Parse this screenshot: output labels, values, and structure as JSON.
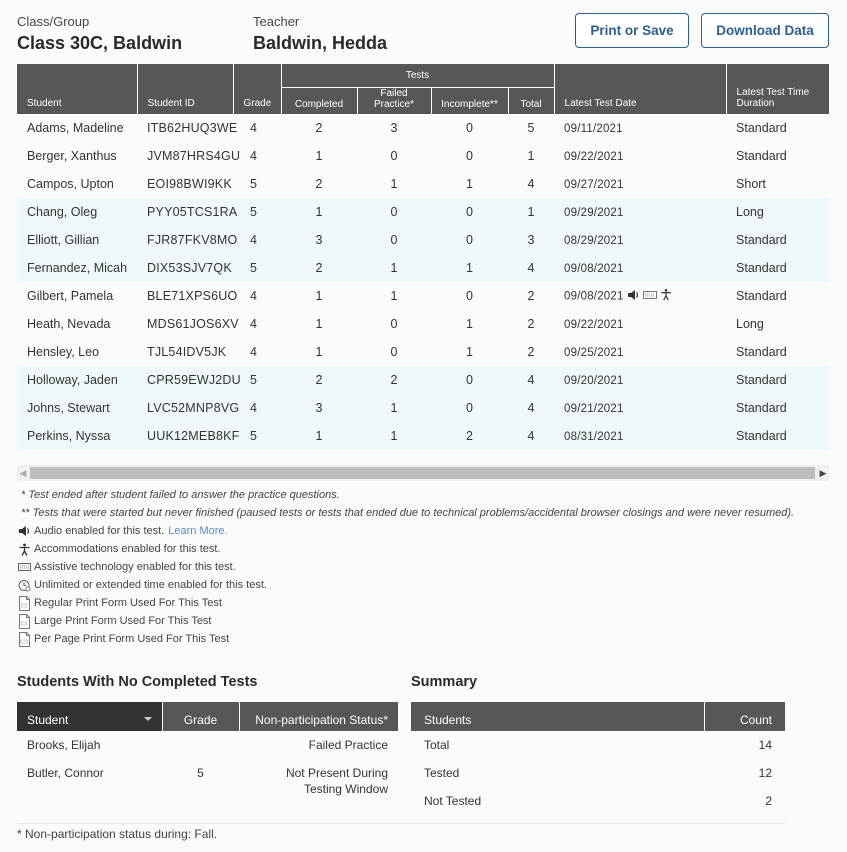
{
  "header": {
    "class_label": "Class/Group",
    "class_value": "Class 30C, Baldwin",
    "teacher_label": "Teacher",
    "teacher_value": "Baldwin, Hedda",
    "print_button": "Print or Save",
    "download_button": "Download Data"
  },
  "main_table": {
    "headers": {
      "student": "Student",
      "student_id": "Student ID",
      "grade": "Grade",
      "tests_group": "Tests",
      "completed": "Completed",
      "failed_practice": "Failed Practice*",
      "incomplete": "Incomplete**",
      "total": "Total",
      "latest_date": "Latest Test Date",
      "latest_duration": "Latest Test Time Duration"
    },
    "rows": [
      {
        "student": "Adams, Madeline",
        "id": "ITB62HUQ3WE",
        "grade": "4",
        "completed": "2",
        "failed": "3",
        "incomplete": "0",
        "total": "5",
        "date": "09/11/2021",
        "icons": [],
        "duration": "Standard",
        "highlight": false
      },
      {
        "student": "Berger, Xanthus",
        "id": "JVM87HRS4GU",
        "grade": "4",
        "completed": "1",
        "failed": "0",
        "incomplete": "0",
        "total": "1",
        "date": "09/22/2021",
        "icons": [],
        "duration": "Standard",
        "highlight": false
      },
      {
        "student": "Campos, Upton",
        "id": "EOI98BWI9KK",
        "grade": "5",
        "completed": "2",
        "failed": "1",
        "incomplete": "1",
        "total": "4",
        "date": "09/27/2021",
        "icons": [],
        "duration": "Short",
        "highlight": false
      },
      {
        "student": "Chang, Oleg",
        "id": "PYY05TCS1RA",
        "grade": "5",
        "completed": "1",
        "failed": "0",
        "incomplete": "0",
        "total": "1",
        "date": "09/29/2021",
        "icons": [],
        "duration": "Long",
        "highlight": true
      },
      {
        "student": "Elliott, Gillian",
        "id": "FJR87FKV8MO",
        "grade": "4",
        "completed": "3",
        "failed": "0",
        "incomplete": "0",
        "total": "3",
        "date": "08/29/2021",
        "icons": [],
        "duration": "Standard",
        "highlight": true
      },
      {
        "student": "Fernandez, Micah",
        "id": "DIX53SJV7QK",
        "grade": "5",
        "completed": "2",
        "failed": "1",
        "incomplete": "1",
        "total": "4",
        "date": "09/08/2021",
        "icons": [],
        "duration": "Standard",
        "highlight": true
      },
      {
        "student": "Gilbert, Pamela",
        "id": "BLE71XPS6UO",
        "grade": "4",
        "completed": "1",
        "failed": "1",
        "incomplete": "0",
        "total": "2",
        "date": "09/08/2021",
        "icons": [
          "audio-icon",
          "keyboard-icon",
          "accommodation-icon"
        ],
        "duration": "Standard",
        "highlight": false
      },
      {
        "student": "Heath, Nevada",
        "id": "MDS61JOS6XV",
        "grade": "4",
        "completed": "1",
        "failed": "0",
        "incomplete": "1",
        "total": "2",
        "date": "09/22/2021",
        "icons": [],
        "duration": "Long",
        "highlight": false
      },
      {
        "student": "Hensley, Leo",
        "id": "TJL54IDV5JK",
        "grade": "4",
        "completed": "1",
        "failed": "0",
        "incomplete": "1",
        "total": "2",
        "date": "09/25/2021",
        "icons": [],
        "duration": "Standard",
        "highlight": false
      },
      {
        "student": "Holloway, Jaden",
        "id": "CPR59EWJ2DU",
        "grade": "5",
        "completed": "2",
        "failed": "2",
        "incomplete": "0",
        "total": "4",
        "date": "09/20/2021",
        "icons": [],
        "duration": "Standard",
        "highlight": true
      },
      {
        "student": "Johns, Stewart",
        "id": "LVC52MNP8VG",
        "grade": "4",
        "completed": "3",
        "failed": "1",
        "incomplete": "0",
        "total": "4",
        "date": "09/21/2021",
        "icons": [],
        "duration": "Standard",
        "highlight": true
      },
      {
        "student": "Perkins, Nyssa",
        "id": "UUK12MEB8KF",
        "grade": "5",
        "completed": "1",
        "failed": "1",
        "incomplete": "2",
        "total": "4",
        "date": "08/31/2021",
        "icons": [],
        "duration": "Standard",
        "highlight": true
      }
    ]
  },
  "scrollbar": {
    "left_arrow": "◀",
    "right_arrow": "▶"
  },
  "notes": {
    "failed_practice": "* Test ended after student failed to answer the practice questions.",
    "incomplete": "** Tests that were started but never finished (paused tests or tests that ended due to technical problems/accidental browser closings and were never resumed)."
  },
  "legend": {
    "audio": "Audio enabled for this test.",
    "learn_more": "Learn More.",
    "accommodations": "Accommodations enabled for this test.",
    "assistive": "Assistive technology enabled for this test.",
    "unlimited_time": "Unlimited or extended time enabled for this test.",
    "regular_print": "Regular Print Form Used For This Test",
    "large_print": "Large Print Form Used For This Test",
    "per_page_print": "Per Page Print Form Used For This Test"
  },
  "no_completed": {
    "title": "Students With No Completed Tests",
    "headers": {
      "student": "Student",
      "grade": "Grade",
      "status": "Non-participation Status*"
    },
    "rows": [
      {
        "student": "Brooks, Elijah",
        "grade": "",
        "status": "Failed Practice"
      },
      {
        "student": "Butler, Connor",
        "grade": "5",
        "status": "Not Present During Testing Window"
      }
    ]
  },
  "summary": {
    "title": "Summary",
    "headers": {
      "students": "Students",
      "count": "Count"
    },
    "rows": [
      {
        "label": "Total",
        "count": "14"
      },
      {
        "label": "Tested",
        "count": "12"
      },
      {
        "label": "Not Tested",
        "count": "2"
      }
    ]
  },
  "footnote": "* Non-participation status during: Fall.",
  "colors": {
    "header_bg": "#575757",
    "sorted_header_bg": "#333333",
    "highlight_row": "#eff9fb",
    "button_border": "#2b5f8e",
    "link": "#4f8fd0"
  }
}
